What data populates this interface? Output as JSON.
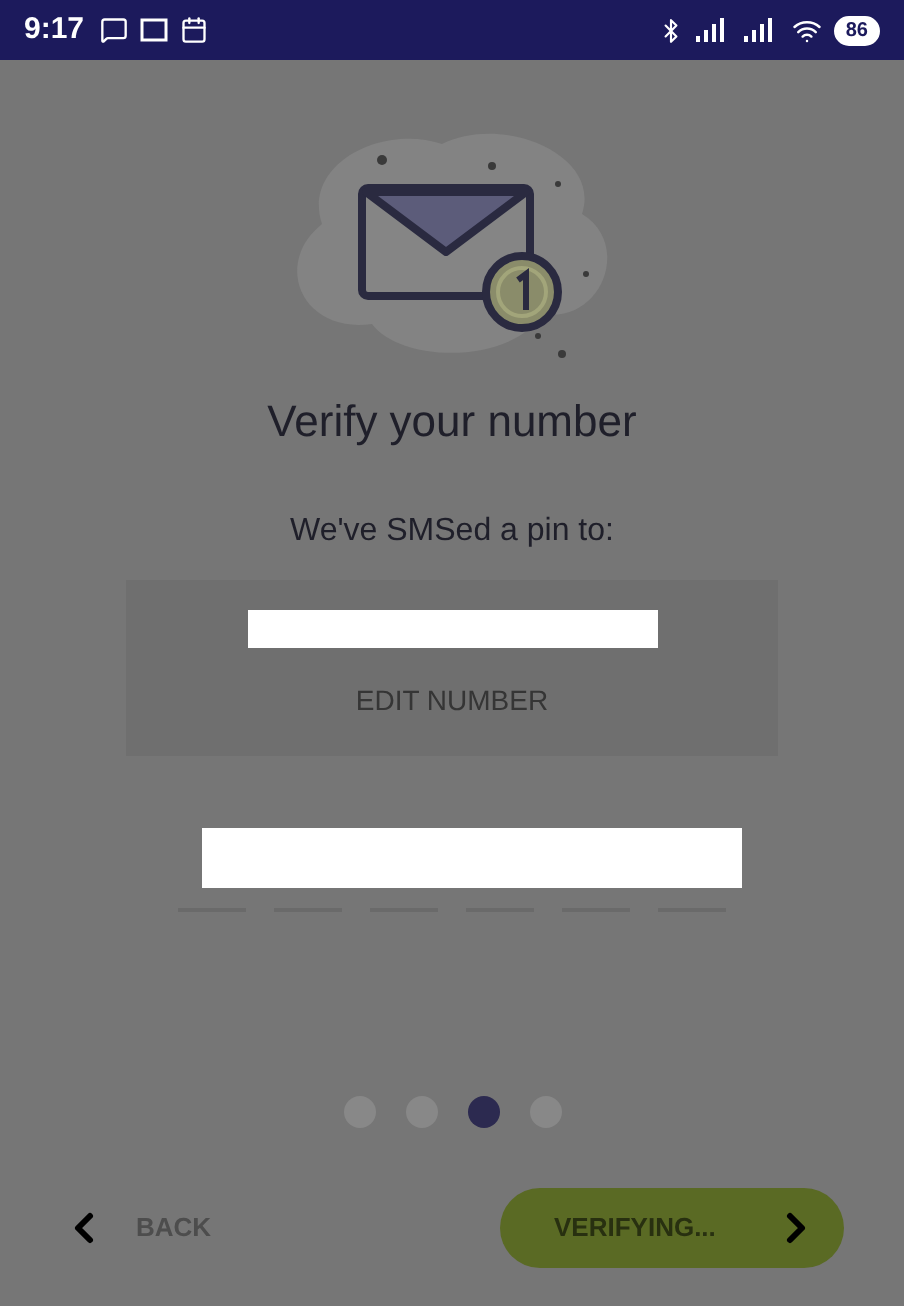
{
  "status_bar": {
    "time": "9:17",
    "battery": "86"
  },
  "title": "Verify your number",
  "subtitle": "We've SMSed a pin to:",
  "edit_button": "EDIT NUMBER",
  "pager": [
    {
      "selected": false
    },
    {
      "selected": false
    },
    {
      "selected": true
    },
    {
      "selected": false
    }
  ],
  "back_button": "BACK",
  "next_button": {
    "label": "VERIFYING...",
    "disabled": true
  }
}
